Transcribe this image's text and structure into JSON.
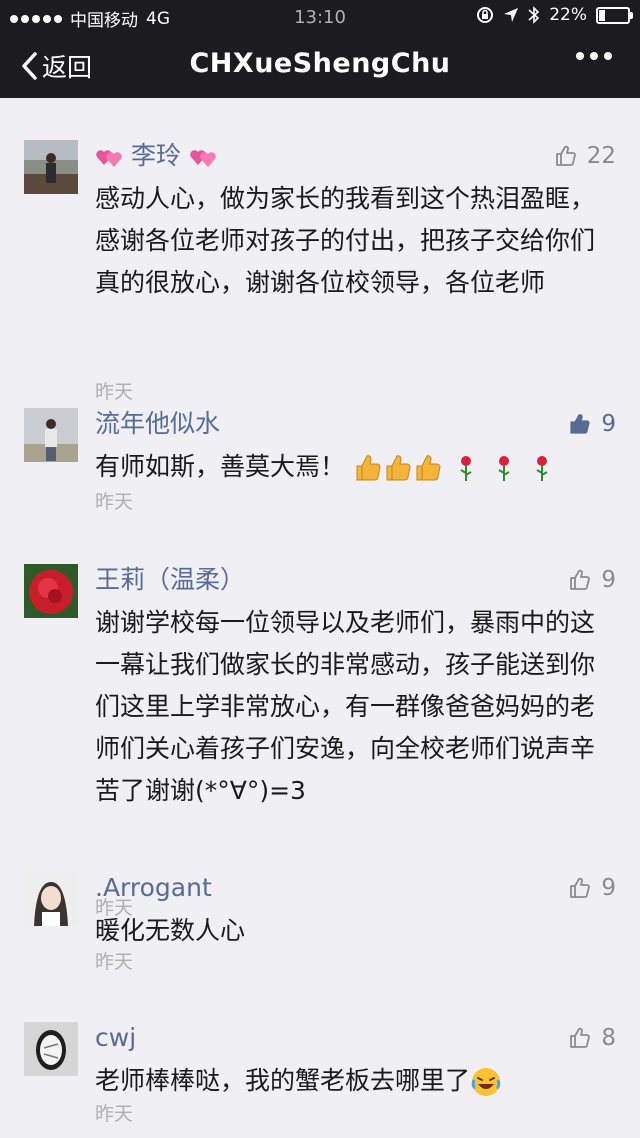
{
  "status_bar": {
    "carrier": "中国移动",
    "network": "4G",
    "time": "13:10",
    "battery": "22%"
  },
  "nav": {
    "back_label": "返回",
    "title": "CHXueShengChu"
  },
  "comments": [
    {
      "name": "李玲",
      "likes": "22",
      "liked": false,
      "text": "感动人心，做为家长的我看到这个热泪盈眶，感谢各位老师对孩子的付出，把孩子交给你们真的很放心，谢谢各位校领导，各位老师",
      "time": "昨天"
    },
    {
      "name": "流年他似水",
      "likes": "9",
      "liked": true,
      "text": "有师如斯，善莫大焉！",
      "time": "昨天"
    },
    {
      "name": "王莉（温柔）",
      "likes": "9",
      "liked": false,
      "text": "谢谢学校每一位领导以及老师们，暴雨中的这一幕让我们做家长的非常感动，孩子能送到你们这里上学非常放心，有一群像爸爸妈妈的老师们关心着孩子们安逸，向全校老师们说声辛苦了谢谢(*°∀°)=3",
      "time": "昨天"
    },
    {
      "name": ".Arrogant",
      "likes": "9",
      "liked": false,
      "text": "暖化无数人心",
      "time": "昨天"
    },
    {
      "name": "cwj",
      "likes": "8",
      "liked": false,
      "text": "老师棒棒哒，我的蟹老板去哪里了",
      "time": "昨天"
    }
  ],
  "icons": {
    "like": "thumbs-up-icon",
    "back": "chevron-left-icon",
    "more": "more-dots-icon"
  },
  "colors": {
    "nav_bg": "#1c1c20",
    "name": "#576b95",
    "like_active": "#576b95",
    "like_inactive": "#8a8a8f"
  }
}
